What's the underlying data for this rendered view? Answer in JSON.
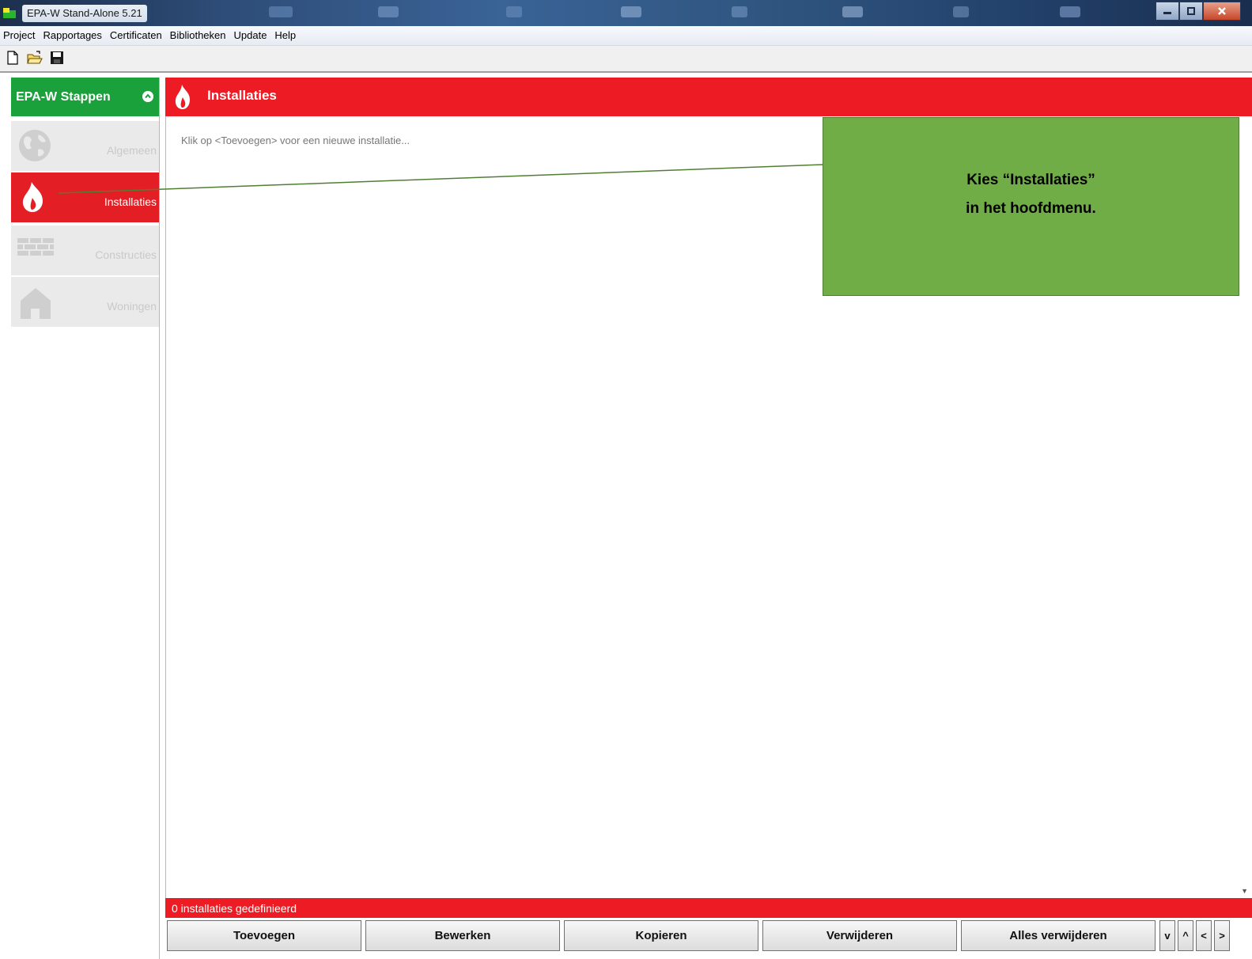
{
  "window": {
    "title": "EPA-W Stand-Alone 5.21"
  },
  "menu": [
    "Project",
    "Rapportages",
    "Certificaten",
    "Bibliotheken",
    "Update",
    "Help"
  ],
  "toolbar": {
    "icons": [
      "new-file-icon",
      "open-folder-icon",
      "save-icon"
    ]
  },
  "steps_panel": {
    "title": "EPA-W Stappen",
    "items": [
      {
        "label": "Algemeen",
        "icon": "globe-icon",
        "active": false
      },
      {
        "label": "Installaties",
        "icon": "flame-icon",
        "active": true
      },
      {
        "label": "Constructies",
        "icon": "brick-wall-icon",
        "active": false
      },
      {
        "label": "Woningen",
        "icon": "house-icon",
        "active": false
      }
    ]
  },
  "main": {
    "title": "Installaties",
    "hint": "Klik op <Toevoegen> voor een nieuwe installatie...",
    "status": "0 installaties gedefinieerd",
    "buttons": [
      "Toevoegen",
      "Bewerken",
      "Kopieren",
      "Verwijderen",
      "Alles verwijderen"
    ],
    "nav_buttons": [
      "v",
      "^",
      "<",
      ">"
    ]
  },
  "annotation": {
    "line1": "Kies “Installaties”",
    "line2": "in het hoofdmenu."
  },
  "colors": {
    "accent_red": "#ed1c24",
    "steps_green": "#1aa13c",
    "callout_green": "#70ad47"
  }
}
